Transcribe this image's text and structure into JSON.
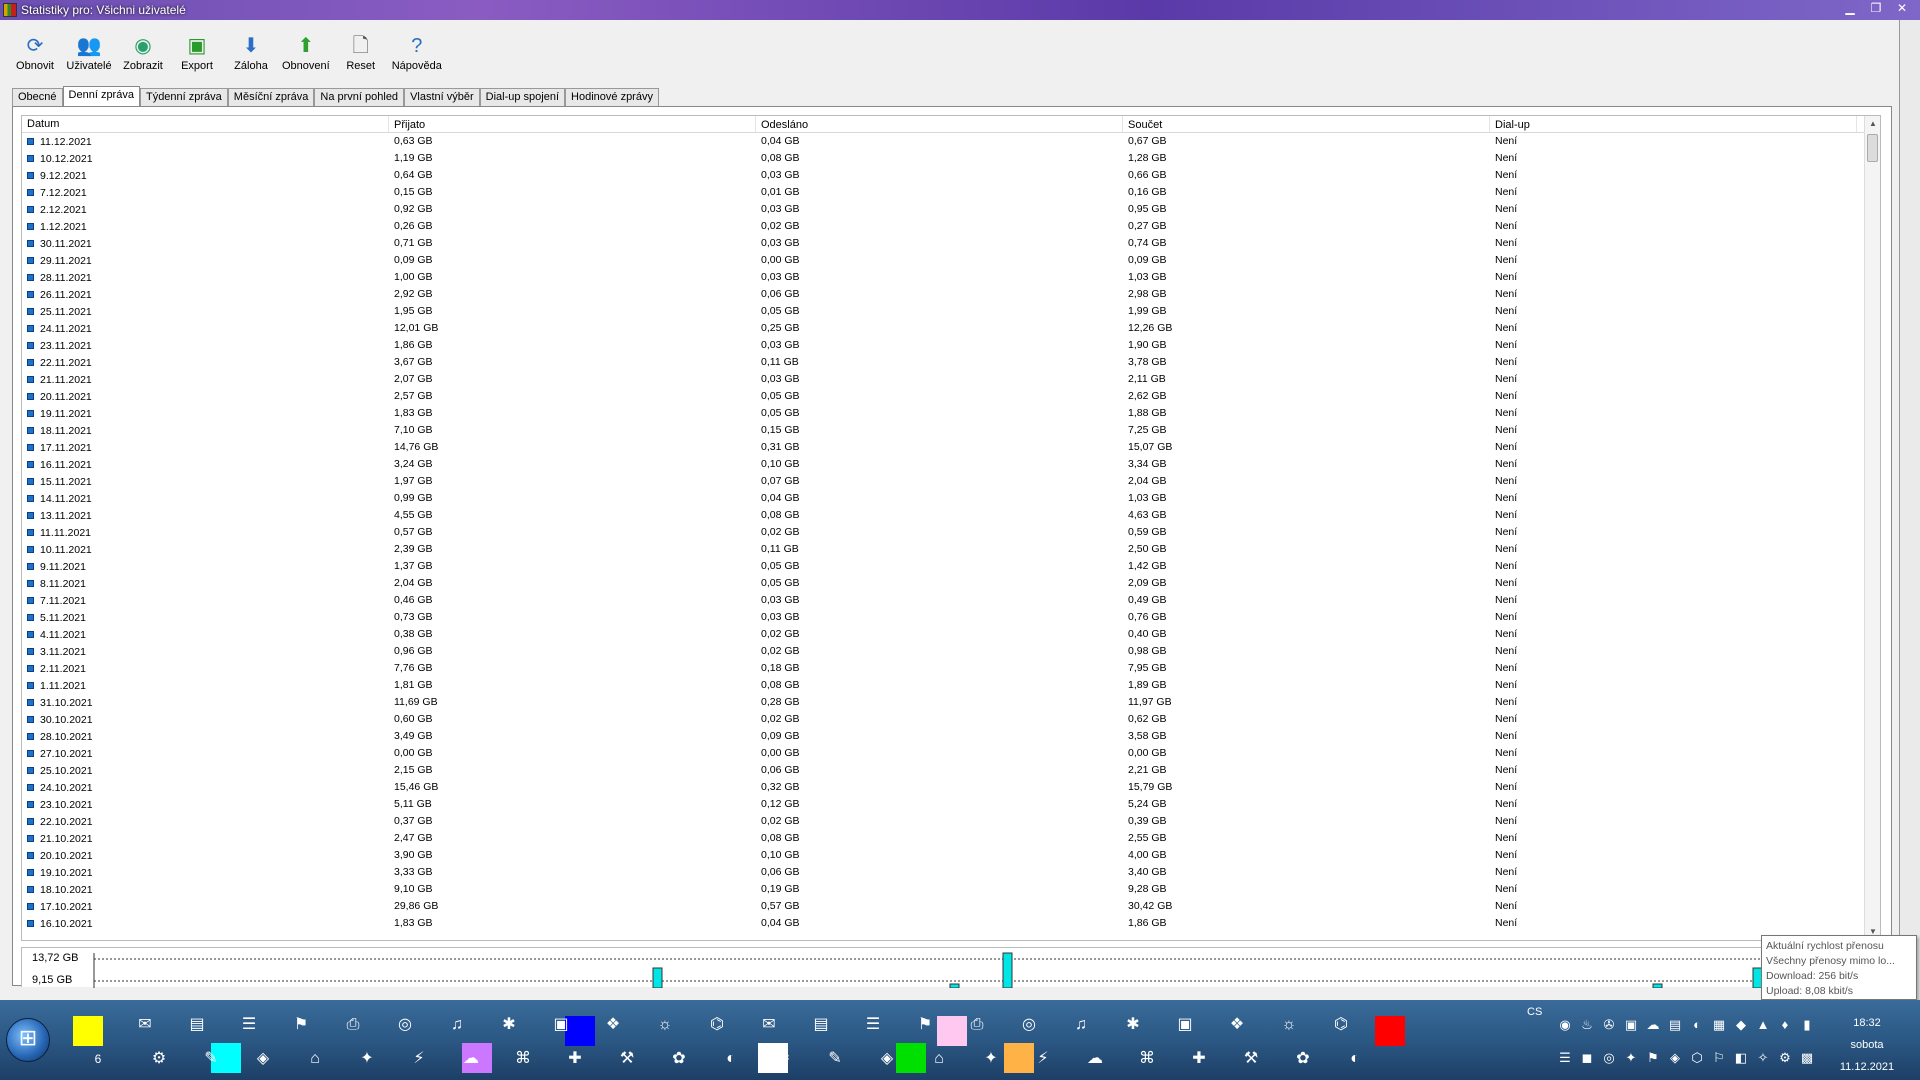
{
  "window": {
    "title": "Statistiky pro: Všichni uživatelé"
  },
  "toolbar": [
    {
      "label": "Obnovit",
      "icon": "refresh-icon",
      "glyph": "⟳",
      "color": "#2b6fc4"
    },
    {
      "label": "Uživatelé",
      "icon": "users-icon",
      "glyph": "👥",
      "color": "#c0662a"
    },
    {
      "label": "Zobrazit",
      "icon": "view-icon",
      "glyph": "◉",
      "color": "#2aa06b"
    },
    {
      "label": "Export",
      "icon": "save-icon",
      "glyph": "▣",
      "color": "#2a9a2a"
    },
    {
      "label": "Záloha",
      "icon": "arrow-down-icon",
      "glyph": "⬇",
      "color": "#2b6fc4"
    },
    {
      "label": "Obnovení",
      "icon": "arrow-up-icon",
      "glyph": "⬆",
      "color": "#2fa02f"
    },
    {
      "label": "Reset",
      "icon": "document-icon",
      "glyph": "🗋",
      "color": "#555555"
    },
    {
      "label": "Nápověda",
      "icon": "help-icon",
      "glyph": "?",
      "color": "#2b6fc4"
    }
  ],
  "tabs": [
    "Obecné",
    "Denní zpráva",
    "Týdenní zpráva",
    "Měsíční zpráva",
    "Na první pohled",
    "Vlastní výběr",
    "Dial-up spojení",
    "Hodinové zprávy"
  ],
  "active_tab": 1,
  "table": {
    "headers": [
      "Datum",
      "Přijato",
      "Odesláno",
      "Součet",
      "Dial-up"
    ],
    "rows": [
      [
        "11.12.2021",
        "0,63 GB",
        "0,04 GB",
        "0,67 GB",
        "Není"
      ],
      [
        "10.12.2021",
        "1,19 GB",
        "0,08 GB",
        "1,28 GB",
        "Není"
      ],
      [
        "9.12.2021",
        "0,64 GB",
        "0,03 GB",
        "0,66 GB",
        "Není"
      ],
      [
        "7.12.2021",
        "0,15 GB",
        "0,01 GB",
        "0,16 GB",
        "Není"
      ],
      [
        "2.12.2021",
        "0,92 GB",
        "0,03 GB",
        "0,95 GB",
        "Není"
      ],
      [
        "1.12.2021",
        "0,26 GB",
        "0,02 GB",
        "0,27 GB",
        "Není"
      ],
      [
        "30.11.2021",
        "0,71 GB",
        "0,03 GB",
        "0,74 GB",
        "Není"
      ],
      [
        "29.11.2021",
        "0,09 GB",
        "0,00 GB",
        "0,09 GB",
        "Není"
      ],
      [
        "28.11.2021",
        "1,00 GB",
        "0,03 GB",
        "1,03 GB",
        "Není"
      ],
      [
        "26.11.2021",
        "2,92 GB",
        "0,06 GB",
        "2,98 GB",
        "Není"
      ],
      [
        "25.11.2021",
        "1,95 GB",
        "0,05 GB",
        "1,99 GB",
        "Není"
      ],
      [
        "24.11.2021",
        "12,01 GB",
        "0,25 GB",
        "12,26 GB",
        "Není"
      ],
      [
        "23.11.2021",
        "1,86 GB",
        "0,03 GB",
        "1,90 GB",
        "Není"
      ],
      [
        "22.11.2021",
        "3,67 GB",
        "0,11 GB",
        "3,78 GB",
        "Není"
      ],
      [
        "21.11.2021",
        "2,07 GB",
        "0,03 GB",
        "2,11 GB",
        "Není"
      ],
      [
        "20.11.2021",
        "2,57 GB",
        "0,05 GB",
        "2,62 GB",
        "Není"
      ],
      [
        "19.11.2021",
        "1,83 GB",
        "0,05 GB",
        "1,88 GB",
        "Není"
      ],
      [
        "18.11.2021",
        "7,10 GB",
        "0,15 GB",
        "7,25 GB",
        "Není"
      ],
      [
        "17.11.2021",
        "14,76 GB",
        "0,31 GB",
        "15,07 GB",
        "Není"
      ],
      [
        "16.11.2021",
        "3,24 GB",
        "0,10 GB",
        "3,34 GB",
        "Není"
      ],
      [
        "15.11.2021",
        "1,97 GB",
        "0,07 GB",
        "2,04 GB",
        "Není"
      ],
      [
        "14.11.2021",
        "0,99 GB",
        "0,04 GB",
        "1,03 GB",
        "Není"
      ],
      [
        "13.11.2021",
        "4,55 GB",
        "0,08 GB",
        "4,63 GB",
        "Není"
      ],
      [
        "11.11.2021",
        "0,57 GB",
        "0,02 GB",
        "0,59 GB",
        "Není"
      ],
      [
        "10.11.2021",
        "2,39 GB",
        "0,11 GB",
        "2,50 GB",
        "Není"
      ],
      [
        "9.11.2021",
        "1,37 GB",
        "0,05 GB",
        "1,42 GB",
        "Není"
      ],
      [
        "8.11.2021",
        "2,04 GB",
        "0,05 GB",
        "2,09 GB",
        "Není"
      ],
      [
        "7.11.2021",
        "0,46 GB",
        "0,03 GB",
        "0,49 GB",
        "Není"
      ],
      [
        "5.11.2021",
        "0,73 GB",
        "0,03 GB",
        "0,76 GB",
        "Není"
      ],
      [
        "4.11.2021",
        "0,38 GB",
        "0,02 GB",
        "0,40 GB",
        "Není"
      ],
      [
        "3.11.2021",
        "0,96 GB",
        "0,02 GB",
        "0,98 GB",
        "Není"
      ],
      [
        "2.11.2021",
        "7,76 GB",
        "0,18 GB",
        "7,95 GB",
        "Není"
      ],
      [
        "1.11.2021",
        "1,81 GB",
        "0,08 GB",
        "1,89 GB",
        "Není"
      ],
      [
        "31.10.2021",
        "11,69 GB",
        "0,28 GB",
        "11,97 GB",
        "Není"
      ],
      [
        "30.10.2021",
        "0,60 GB",
        "0,02 GB",
        "0,62 GB",
        "Není"
      ],
      [
        "28.10.2021",
        "3,49 GB",
        "0,09 GB",
        "3,58 GB",
        "Není"
      ],
      [
        "27.10.2021",
        "0,00 GB",
        "0,00 GB",
        "0,00 GB",
        "Není"
      ],
      [
        "25.10.2021",
        "2,15 GB",
        "0,06 GB",
        "2,21 GB",
        "Není"
      ],
      [
        "24.10.2021",
        "15,46 GB",
        "0,32 GB",
        "15,79 GB",
        "Není"
      ],
      [
        "23.10.2021",
        "5,11 GB",
        "0,12 GB",
        "5,24 GB",
        "Není"
      ],
      [
        "22.10.2021",
        "0,37 GB",
        "0,02 GB",
        "0,39 GB",
        "Není"
      ],
      [
        "21.10.2021",
        "2,47 GB",
        "0,08 GB",
        "2,55 GB",
        "Není"
      ],
      [
        "20.10.2021",
        "3,90 GB",
        "0,10 GB",
        "4,00 GB",
        "Není"
      ],
      [
        "19.10.2021",
        "3,33 GB",
        "0,06 GB",
        "3,40 GB",
        "Není"
      ],
      [
        "18.10.2021",
        "9,10 GB",
        "0,19 GB",
        "9,28 GB",
        "Není"
      ],
      [
        "17.10.2021",
        "29,86 GB",
        "0,57 GB",
        "30,42 GB",
        "Není"
      ],
      [
        "16.10.2021",
        "1,83 GB",
        "0,04 GB",
        "1,86 GB",
        "Není"
      ]
    ]
  },
  "chart": {
    "y_labels": [
      "13,72 GB",
      "9,15 GB"
    ],
    "bar_color": "#00e5e5"
  },
  "tooltip": {
    "lines": [
      "Aktuální rychlost přenosu",
      "Všechny přenosy mimo lo...",
      "Download: 256 bit/s",
      "Upload: 8,08 kbit/s"
    ]
  },
  "taskbar": {
    "language": "CS",
    "time": "18:32",
    "day": "sobota",
    "date": "11.12.2021",
    "badge_count": "6",
    "colors": [
      "#ffff00",
      "#0000ff",
      "#00ffff",
      "#cc77ff",
      "#ffffff",
      "#00e000",
      "#ff0000",
      "#ffb347",
      "#ffc8f0"
    ]
  }
}
